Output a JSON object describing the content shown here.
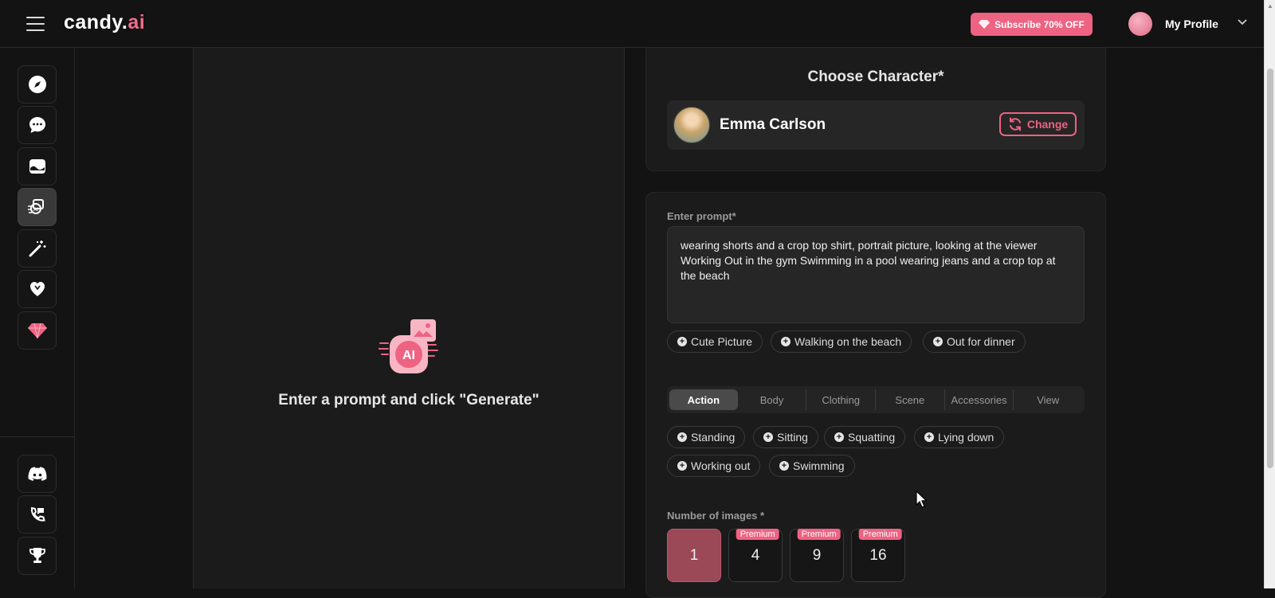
{
  "header": {
    "logo_main": "candy.",
    "logo_accent": "ai",
    "subscribe_label": "Subscribe 70% OFF",
    "profile_label": "My Profile"
  },
  "sidebar": {
    "items": [
      {
        "icon": "compass-icon"
      },
      {
        "icon": "chat-icon"
      },
      {
        "icon": "gallery-icon"
      },
      {
        "icon": "generate-image-icon",
        "active": true
      },
      {
        "icon": "magic-wand-icon"
      },
      {
        "icon": "heart-icon"
      },
      {
        "icon": "diamond-icon"
      }
    ],
    "bottom_items": [
      {
        "icon": "discord-icon"
      },
      {
        "icon": "support-icon"
      },
      {
        "icon": "trophy-icon"
      }
    ]
  },
  "preview": {
    "empty_message": "Enter a prompt and click \"Generate\"",
    "illustration_label": "AI"
  },
  "character": {
    "title": "Choose Character*",
    "name": "Emma Carlson",
    "change_label": "Change"
  },
  "prompt": {
    "label": "Enter prompt*",
    "value": "wearing shorts and a crop top shirt, portrait picture, looking at the viewer Working Out in the gym Swimming in a pool wearing jeans and a crop top at the beach",
    "suggestions": [
      "Cute Picture",
      "Walking on the beach",
      "Out for dinner"
    ]
  },
  "categories": {
    "tabs": [
      "Action",
      "Body",
      "Clothing",
      "Scene",
      "Accessories",
      "View"
    ],
    "active_tab": "Action",
    "action_chips": [
      "Standing",
      "Sitting",
      "Squatting",
      "Lying down",
      "Working out",
      "Swimming"
    ]
  },
  "images": {
    "label": "Number of images *",
    "options": [
      {
        "value": "1",
        "premium": false,
        "selected": true
      },
      {
        "value": "4",
        "premium": true
      },
      {
        "value": "9",
        "premium": true
      },
      {
        "value": "16",
        "premium": true
      }
    ],
    "premium_badge": "Premium"
  },
  "colors": {
    "accent": "#ee6282",
    "background": "#131313",
    "panel": "#1b1b1b"
  }
}
